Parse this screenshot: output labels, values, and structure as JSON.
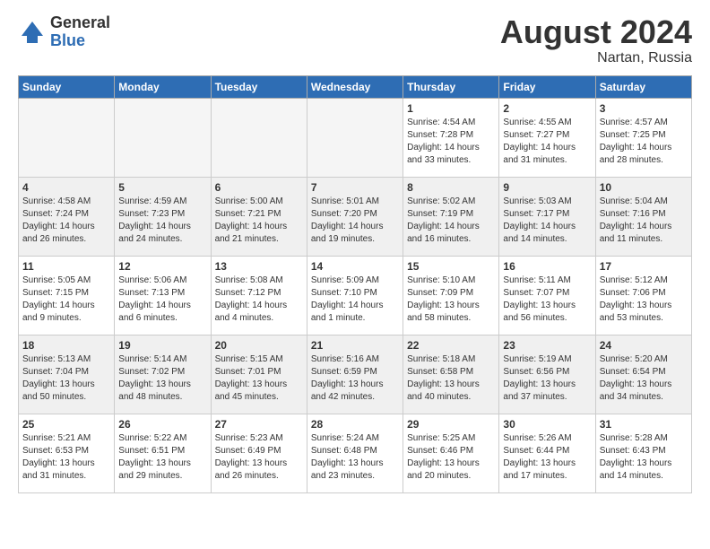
{
  "logo": {
    "general": "General",
    "blue": "Blue"
  },
  "title": "August 2024",
  "location": "Nartan, Russia",
  "days_header": [
    "Sunday",
    "Monday",
    "Tuesday",
    "Wednesday",
    "Thursday",
    "Friday",
    "Saturday"
  ],
  "weeks": [
    [
      {
        "day": "",
        "detail": ""
      },
      {
        "day": "",
        "detail": ""
      },
      {
        "day": "",
        "detail": ""
      },
      {
        "day": "",
        "detail": ""
      },
      {
        "day": "1",
        "detail": "Sunrise: 4:54 AM\nSunset: 7:28 PM\nDaylight: 14 hours\nand 33 minutes."
      },
      {
        "day": "2",
        "detail": "Sunrise: 4:55 AM\nSunset: 7:27 PM\nDaylight: 14 hours\nand 31 minutes."
      },
      {
        "day": "3",
        "detail": "Sunrise: 4:57 AM\nSunset: 7:25 PM\nDaylight: 14 hours\nand 28 minutes."
      }
    ],
    [
      {
        "day": "4",
        "detail": "Sunrise: 4:58 AM\nSunset: 7:24 PM\nDaylight: 14 hours\nand 26 minutes."
      },
      {
        "day": "5",
        "detail": "Sunrise: 4:59 AM\nSunset: 7:23 PM\nDaylight: 14 hours\nand 24 minutes."
      },
      {
        "day": "6",
        "detail": "Sunrise: 5:00 AM\nSunset: 7:21 PM\nDaylight: 14 hours\nand 21 minutes."
      },
      {
        "day": "7",
        "detail": "Sunrise: 5:01 AM\nSunset: 7:20 PM\nDaylight: 14 hours\nand 19 minutes."
      },
      {
        "day": "8",
        "detail": "Sunrise: 5:02 AM\nSunset: 7:19 PM\nDaylight: 14 hours\nand 16 minutes."
      },
      {
        "day": "9",
        "detail": "Sunrise: 5:03 AM\nSunset: 7:17 PM\nDaylight: 14 hours\nand 14 minutes."
      },
      {
        "day": "10",
        "detail": "Sunrise: 5:04 AM\nSunset: 7:16 PM\nDaylight: 14 hours\nand 11 minutes."
      }
    ],
    [
      {
        "day": "11",
        "detail": "Sunrise: 5:05 AM\nSunset: 7:15 PM\nDaylight: 14 hours\nand 9 minutes."
      },
      {
        "day": "12",
        "detail": "Sunrise: 5:06 AM\nSunset: 7:13 PM\nDaylight: 14 hours\nand 6 minutes."
      },
      {
        "day": "13",
        "detail": "Sunrise: 5:08 AM\nSunset: 7:12 PM\nDaylight: 14 hours\nand 4 minutes."
      },
      {
        "day": "14",
        "detail": "Sunrise: 5:09 AM\nSunset: 7:10 PM\nDaylight: 14 hours\nand 1 minute."
      },
      {
        "day": "15",
        "detail": "Sunrise: 5:10 AM\nSunset: 7:09 PM\nDaylight: 13 hours\nand 58 minutes."
      },
      {
        "day": "16",
        "detail": "Sunrise: 5:11 AM\nSunset: 7:07 PM\nDaylight: 13 hours\nand 56 minutes."
      },
      {
        "day": "17",
        "detail": "Sunrise: 5:12 AM\nSunset: 7:06 PM\nDaylight: 13 hours\nand 53 minutes."
      }
    ],
    [
      {
        "day": "18",
        "detail": "Sunrise: 5:13 AM\nSunset: 7:04 PM\nDaylight: 13 hours\nand 50 minutes."
      },
      {
        "day": "19",
        "detail": "Sunrise: 5:14 AM\nSunset: 7:02 PM\nDaylight: 13 hours\nand 48 minutes."
      },
      {
        "day": "20",
        "detail": "Sunrise: 5:15 AM\nSunset: 7:01 PM\nDaylight: 13 hours\nand 45 minutes."
      },
      {
        "day": "21",
        "detail": "Sunrise: 5:16 AM\nSunset: 6:59 PM\nDaylight: 13 hours\nand 42 minutes."
      },
      {
        "day": "22",
        "detail": "Sunrise: 5:18 AM\nSunset: 6:58 PM\nDaylight: 13 hours\nand 40 minutes."
      },
      {
        "day": "23",
        "detail": "Sunrise: 5:19 AM\nSunset: 6:56 PM\nDaylight: 13 hours\nand 37 minutes."
      },
      {
        "day": "24",
        "detail": "Sunrise: 5:20 AM\nSunset: 6:54 PM\nDaylight: 13 hours\nand 34 minutes."
      }
    ],
    [
      {
        "day": "25",
        "detail": "Sunrise: 5:21 AM\nSunset: 6:53 PM\nDaylight: 13 hours\nand 31 minutes."
      },
      {
        "day": "26",
        "detail": "Sunrise: 5:22 AM\nSunset: 6:51 PM\nDaylight: 13 hours\nand 29 minutes."
      },
      {
        "day": "27",
        "detail": "Sunrise: 5:23 AM\nSunset: 6:49 PM\nDaylight: 13 hours\nand 26 minutes."
      },
      {
        "day": "28",
        "detail": "Sunrise: 5:24 AM\nSunset: 6:48 PM\nDaylight: 13 hours\nand 23 minutes."
      },
      {
        "day": "29",
        "detail": "Sunrise: 5:25 AM\nSunset: 6:46 PM\nDaylight: 13 hours\nand 20 minutes."
      },
      {
        "day": "30",
        "detail": "Sunrise: 5:26 AM\nSunset: 6:44 PM\nDaylight: 13 hours\nand 17 minutes."
      },
      {
        "day": "31",
        "detail": "Sunrise: 5:28 AM\nSunset: 6:43 PM\nDaylight: 13 hours\nand 14 minutes."
      }
    ]
  ]
}
